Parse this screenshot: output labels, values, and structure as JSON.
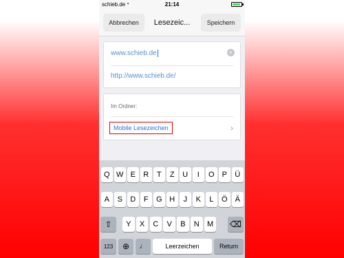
{
  "status_bar": {
    "carrier": "schieb.de",
    "wifi_icon": "◔",
    "time": "21:14"
  },
  "nav": {
    "cancel_label": "Abbrechen",
    "title": "Lesezeic...",
    "save_label": "Speichern"
  },
  "bookmark": {
    "title_value": "www.schieb.de",
    "url_value": "http://www.schieb.de/",
    "clear_glyph": "×"
  },
  "folder": {
    "label": "Im Ordner:",
    "value": "Mobile Lesezeichen",
    "chevron_glyph": "›"
  },
  "highlight_color": "#e60000",
  "keyboard": {
    "row1": [
      "Q",
      "W",
      "E",
      "R",
      "T",
      "Z",
      "U",
      "I",
      "O",
      "P",
      "Ü"
    ],
    "row2": [
      "A",
      "S",
      "D",
      "F",
      "G",
      "H",
      "J",
      "K",
      "L",
      "Ö",
      "Ä"
    ],
    "row3": [
      "Y",
      "X",
      "C",
      "V",
      "B",
      "N",
      "M"
    ],
    "shift_glyph": "⇧",
    "delete_glyph": "⌫",
    "numbers_label": "123",
    "globe_glyph": "⊕",
    "mic_glyph": "♩",
    "space_label": "Leerzeichen",
    "return_label": "Return"
  }
}
